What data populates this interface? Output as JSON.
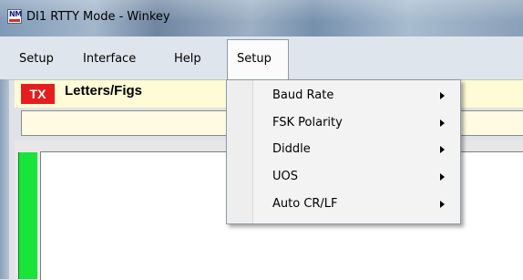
{
  "window": {
    "title": "DI1 RTTY Mode - Winkey",
    "icon": "nm-app-icon"
  },
  "menubar": {
    "items": [
      {
        "label": "Setup"
      },
      {
        "label": "Interface"
      },
      {
        "label": "Help"
      }
    ],
    "open_menu": {
      "label": "Setup"
    }
  },
  "status": {
    "tx_label": "TX",
    "mode_label": "Letters/Figs",
    "tx_color": "#e41e1e",
    "panel_color": "#fffbd6"
  },
  "dropdown": {
    "items": [
      {
        "label": "Baud Rate",
        "submenu": true
      },
      {
        "label": "FSK Polarity",
        "submenu": true
      },
      {
        "label": "Diddle",
        "submenu": true
      },
      {
        "label": "UOS",
        "submenu": true
      },
      {
        "label": "Auto CR/LF",
        "submenu": true
      }
    ],
    "arrow_icon": "chevron-right-icon"
  },
  "input": {
    "value": ""
  },
  "indicator_color": "#19e43a"
}
